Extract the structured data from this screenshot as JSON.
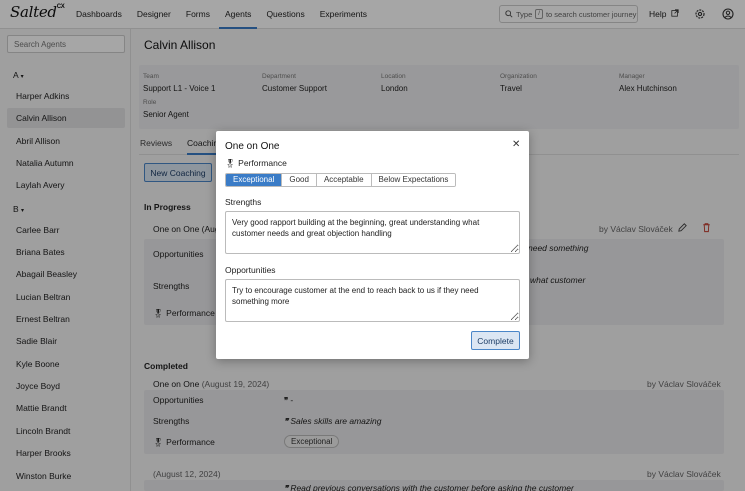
{
  "app": {
    "logo_text": "Salted",
    "logo_sup": "CX"
  },
  "nav": {
    "items": [
      "Dashboards",
      "Designer",
      "Forms",
      "Agents",
      "Questions",
      "Experiments"
    ],
    "active": "Agents"
  },
  "search": {
    "prefix": "Type",
    "key": "/",
    "suffix": "to search customer journey"
  },
  "help_label": "Help",
  "icons": {
    "search": "search-icon",
    "external": "external-link-icon",
    "settings": "gear-icon",
    "user": "user-icon",
    "edit": "pencil-icon",
    "delete": "trash-icon",
    "close": "close-icon",
    "medal": "medal-icon"
  },
  "sidebar": {
    "search_placeholder": "Search Agents",
    "groups": [
      {
        "letter": "A",
        "agents": [
          "Harper Adkins",
          "Calvin Allison",
          "Abril Allison",
          "Natalia Autumn",
          "Laylah Avery"
        ]
      },
      {
        "letter": "B",
        "agents": [
          "Carlee Barr",
          "Briana Bates",
          "Abagail Beasley",
          "Lucian Beltran",
          "Ernest Beltran",
          "Sadie Blair",
          "Kyle Boone",
          "Joyce Boyd",
          "Mattie Brandt",
          "Lincoln Brandt",
          "Harper Brooks",
          "Winston Burke"
        ]
      }
    ],
    "selected": "Calvin Allison"
  },
  "agent": {
    "name": "Calvin Allison",
    "team_label": "Team",
    "team": "Support L1 - Voice 1",
    "department_label": "Department",
    "department": "Customer Support",
    "location_label": "Location",
    "location": "London",
    "organization_label": "Organization",
    "organization": "Travel",
    "manager_label": "Manager",
    "manager": "Alex Hutchinson",
    "role_label": "Role",
    "role": "Senior Agent"
  },
  "tabs": {
    "reviews": "Reviews",
    "coaching": "Coaching"
  },
  "new_coaching_label": "New Coaching",
  "in_progress": {
    "title": "In Progress",
    "session": "One on One (Aug",
    "author": "by Václav Slováček",
    "opportunities_label": "Opportunities",
    "opportunities_tail": "need something",
    "strengths_label": "Strengths",
    "strengths_tail": "what customer",
    "performance_label": "Performance"
  },
  "completed": {
    "title": "Completed",
    "items": [
      {
        "session": "One on One",
        "date": "(August 19, 2024)",
        "author": "by Václav Slováček",
        "opportunities_label": "Opportunities",
        "opportunities_value": "-",
        "strengths_label": "Strengths",
        "strengths_value": "Sales skills are amazing",
        "performance_label": "Performance",
        "performance_value": "Exceptional"
      },
      {
        "date": "(August 12, 2024)",
        "author": "by Václav Slováček",
        "preview": "Read previous conversations with the customer before asking the customer"
      }
    ]
  },
  "modal": {
    "title": "One on One",
    "subtitle": "Performance",
    "options": [
      "Exceptional",
      "Good",
      "Acceptable",
      "Below Expectations"
    ],
    "selected_option": "Exceptional",
    "strengths_label": "Strengths",
    "strengths_value": "Very good rapport building at the beginning, great understanding what customer needs and great objection handling",
    "opportunities_label": "Opportunities",
    "opportunities_value": "Try to encourage customer at the end to reach back to us if they need something more",
    "complete_label": "Complete"
  }
}
